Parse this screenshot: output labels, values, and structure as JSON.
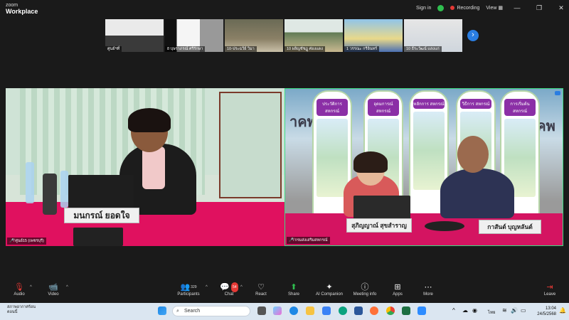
{
  "app": {
    "brand_top": "zoom",
    "brand_bottom": "Workplace"
  },
  "titlebar": {
    "sign_in": "Sign in",
    "recording": "Recording",
    "view": "View",
    "minimize_icon": "minimize-icon",
    "maximize_icon": "maximize-icon",
    "close_icon": "close-icon"
  },
  "gallery": [
    {
      "name": "ศูนย์ฯที่"
    },
    {
      "name": "8 บุษราภรณ์ ศรีรักษา"
    },
    {
      "name": "10-ประฉวีย์ วิมา"
    },
    {
      "name": "10 ผลิญชัชฏู ศ่องแดง"
    },
    {
      "name": "1 วรรณะ กรีอินทร์"
    },
    {
      "name": "10 ธีระวัฒน์ แสงแก่"
    }
  ],
  "videos": {
    "left": {
      "label": "ศูนย์15 (เพชรบุรี)",
      "nameplate": "มนกรณ์ ยอดใจ"
    },
    "right": {
      "label": "กรมส่งเสริมสหกรณ์",
      "plate1": "สุภิญญาณ์ สุขสำราญ",
      "plate2": "กาสันต์ บุญหลันต์",
      "wall_text": "าคพ",
      "poster_titles": [
        "ประวัติการ สหกรณ์",
        "อุดมการณ์ สหกรณ์",
        "หลักการ สหกรณ์",
        "วิธีการ สหกรณ์",
        "การเริ่มต้น สหกรณ์"
      ]
    }
  },
  "toolbar": {
    "audio": "Audio",
    "video": "Video",
    "participants": "Participants",
    "participants_count": "329",
    "chat": "Chat",
    "chat_badge": "54",
    "react": "React",
    "share": "Share",
    "ai": "AI Companion",
    "meeting_info": "Meeting info",
    "apps": "Apps",
    "more": "More",
    "leave": "Leave"
  },
  "taskbar": {
    "weather_line1": "สภาพอากาศร้อน",
    "weather_line2": "ตอนนี้",
    "search": "Search",
    "lang": "ไทย",
    "time": "13:04",
    "date": "24/5/2568"
  },
  "colors": {
    "accent_green": "#3ddc84",
    "pink_table": "#e0115f",
    "taskbar": "#dbe6f1"
  }
}
